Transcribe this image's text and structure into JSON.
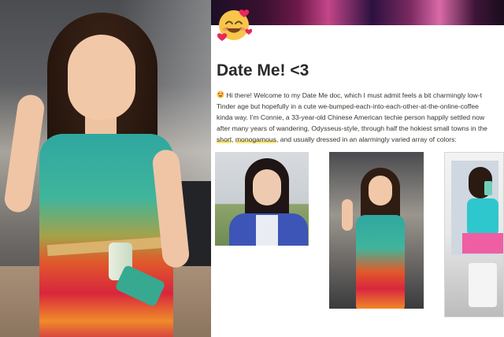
{
  "page": {
    "title": "Date Me! <3",
    "intro_lines": [
      {
        "parts": [
          {
            "text": "Hi there! Welcome to my Date Me doc, which I must admit feels a bit charmingly low-t",
            "hl": false
          }
        ]
      },
      {
        "parts": [
          {
            "text": "Tinder age but hopefully in a cute we-bumped-each-into-each-other-at-the-online-coffee",
            "hl": false
          }
        ]
      },
      {
        "parts": [
          {
            "text": "kinda way. I'm Connie, a 33-year-old Chinese American techie person happily settled now",
            "hl": false
          }
        ]
      },
      {
        "parts": [
          {
            "text": "after many years of wandering, Odysseus-style, through half the hokiest small towns in the",
            "hl": false
          }
        ]
      },
      {
        "parts": [
          {
            "text": "short",
            "hl": true
          },
          {
            "text": ", ",
            "hl": false
          },
          {
            "text": "monogamous",
            "hl": true
          },
          {
            "text": ", and usually dressed in an alarmingly varied array of colors:",
            "hl": false
          }
        ]
      }
    ]
  },
  "icons": {
    "page_icon": "smiling-face-with-hearts-icon",
    "intro_emoji": "heart-eyes-icon"
  },
  "colors": {
    "highlight": "#f5e67a",
    "text": "#37352f",
    "title": "#2a2a2a"
  }
}
